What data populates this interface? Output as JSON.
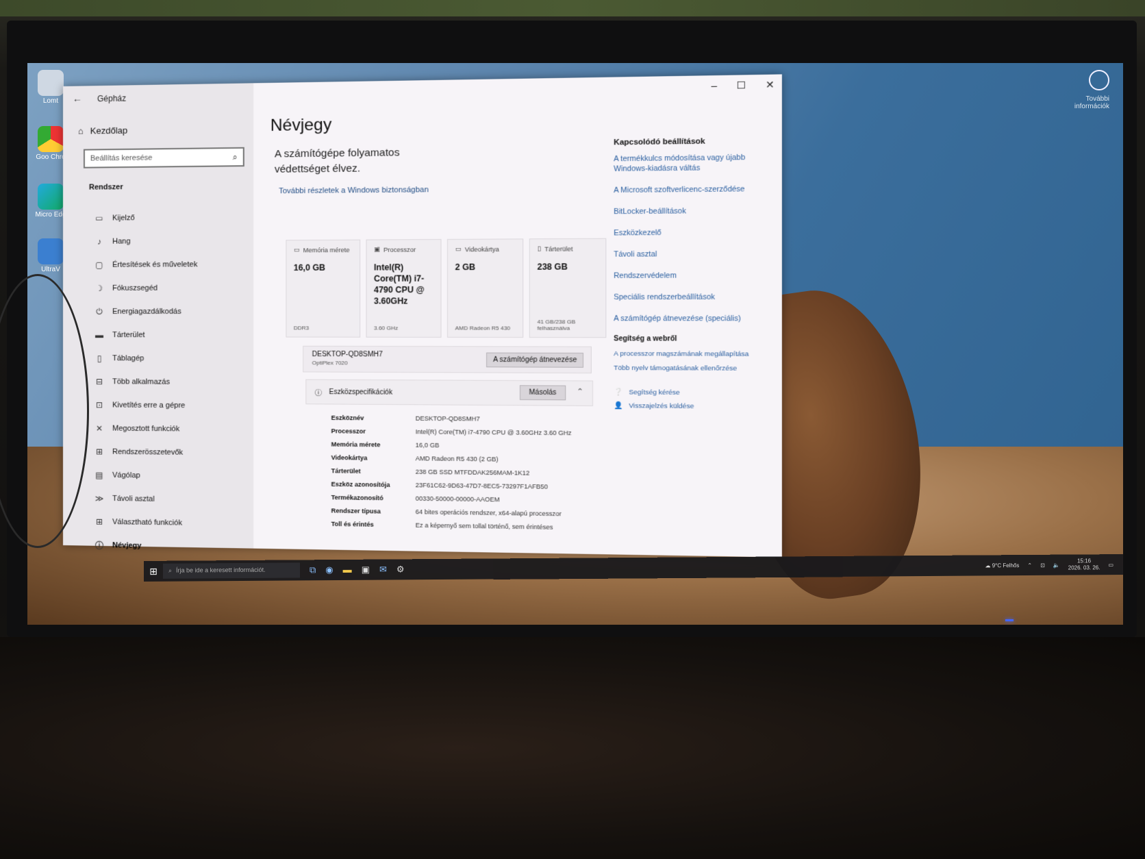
{
  "window": {
    "app_title": "Gépház",
    "controls": [
      "–",
      "☐",
      "✕"
    ]
  },
  "sidebar": {
    "home_label": "Kezdőlap",
    "search_placeholder": "Beállítás keresése",
    "section_label": "Rendszer",
    "items": [
      {
        "label": "Kijelző",
        "icon": "monitor-icon"
      },
      {
        "label": "Hang",
        "icon": "speaker-icon"
      },
      {
        "label": "Értesítések és műveletek",
        "icon": "notification-icon"
      },
      {
        "label": "Fókuszsegéd",
        "icon": "moon-icon"
      },
      {
        "label": "Energiagazdálkodás",
        "icon": "power-icon"
      },
      {
        "label": "Tárterület",
        "icon": "drive-icon"
      },
      {
        "label": "Táblagép",
        "icon": "tablet-icon"
      },
      {
        "label": "Több alkalmazás",
        "icon": "multitask-icon"
      },
      {
        "label": "Kivetítés erre a gépre",
        "icon": "project-icon"
      },
      {
        "label": "Megosztott funkciók",
        "icon": "share-icon"
      },
      {
        "label": "Rendszerösszetevők",
        "icon": "components-icon"
      },
      {
        "label": "Vágólap",
        "icon": "clipboard-icon"
      },
      {
        "label": "Távoli asztal",
        "icon": "remote-icon"
      },
      {
        "label": "Választható funkciók",
        "icon": "features-icon"
      },
      {
        "label": "Névjegy",
        "icon": "info-icon"
      }
    ]
  },
  "main": {
    "title": "Névjegy",
    "protection_text": "A számítógépe folyamatos védettséget élvez.",
    "protection_link": "További részletek a Windows biztonságban",
    "cards": [
      {
        "head": "Memória mérete",
        "value": "16,0 GB",
        "foot": "DDR3"
      },
      {
        "head": "Processzor",
        "value": "Intel(R) Core(TM) i7-4790 CPU @ 3.60GHz",
        "foot": "3.60 GHz"
      },
      {
        "head": "Videokártya",
        "value": "2 GB",
        "foot": "AMD Radeon R5 430"
      },
      {
        "head": "Tárterület",
        "value": "238 GB",
        "foot": "41 GB/238 GB felhasználva"
      }
    ],
    "device_name": "DESKTOP-QD8SMH7",
    "device_model": "OptiPlex 7020",
    "rename_button": "A számítógép átnevezése",
    "spec_header": "Eszközspecifikációk",
    "copy_button": "Másolás",
    "specs": [
      {
        "key": "Eszköznév",
        "value": "DESKTOP-QD8SMH7"
      },
      {
        "key": "Processzor",
        "value": "Intel(R) Core(TM) i7-4790 CPU @ 3.60GHz   3.60 GHz"
      },
      {
        "key": "Memória mérete",
        "value": "16,0 GB"
      },
      {
        "key": "Videokártya",
        "value": "AMD Radeon R5 430 (2 GB)"
      },
      {
        "key": "Tárterület",
        "value": "238 GB SSD MTFDDAK256MAM-1K12"
      },
      {
        "key": "Eszköz azonosítója",
        "value": "23F61C62-9D63-47D7-8EC5-73297F1AFB50"
      },
      {
        "key": "Termékazonosító",
        "value": "00330-50000-00000-AAOEM"
      },
      {
        "key": "Rendszer típusa",
        "value": "64 bites operációs rendszer, x64-alapú processzor"
      },
      {
        "key": "Toll és érintés",
        "value": "Ez a képernyő sem tollal történő, sem érintéses"
      }
    ]
  },
  "related": {
    "title": "Kapcsolódó beállítások",
    "links": [
      "A termékkulcs módosítása vagy újabb Windows-kiadásra váltás",
      "A Microsoft szoftverlicenc-szerződése",
      "BitLocker-beállítások",
      "Eszközkezelő",
      "Távoli asztal",
      "Rendszervédelem",
      "Speciális rendszerbeállítások",
      "A számítógép átnevezése (speciális)"
    ],
    "web_title": "Segítség a webről",
    "web_links": [
      "A processzor magszámának megállapítása",
      "Több nyelv támogatásának ellenőrzése"
    ],
    "help": "Segítség kérése",
    "feedback": "Visszajelzés küldése"
  },
  "taskbar": {
    "search_placeholder": "Írja be ide a keresett információt.",
    "weather": "9°C Felhős",
    "time": "15:16",
    "date": "2026. 03. 26."
  },
  "desktop": {
    "icons": [
      "Lomt",
      "Goo Chro",
      "Micro Edg",
      "UltraV"
    ],
    "right_label": "További információk"
  }
}
